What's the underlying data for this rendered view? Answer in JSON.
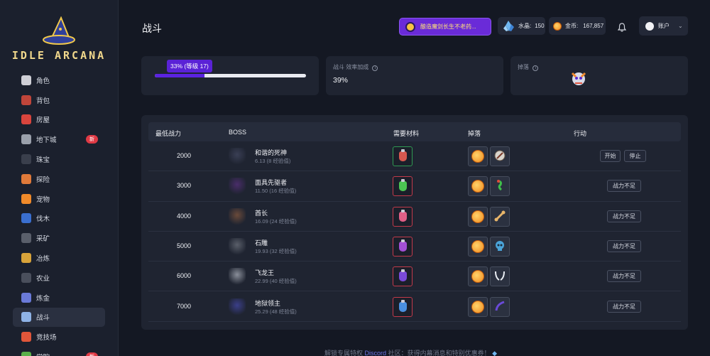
{
  "app": {
    "logo_text": "IDLE ARCANA"
  },
  "sidebar": {
    "items": [
      {
        "label": "角色",
        "icon": "skull-character-icon",
        "color": "#cfcfd6"
      },
      {
        "label": "背包",
        "icon": "backpack-icon",
        "color": "#c0453a"
      },
      {
        "label": "房屋",
        "icon": "house-icon",
        "color": "#d9453d"
      },
      {
        "label": "地下城",
        "icon": "dungeon-gate-icon",
        "color": "#9aa0ab",
        "badge": "新"
      },
      {
        "label": "珠宝",
        "icon": "gem-ring-icon",
        "color": "#3a3f4c"
      },
      {
        "label": "探险",
        "icon": "map-icon",
        "color": "#e07a3a"
      },
      {
        "label": "宠物",
        "icon": "pet-egg-icon",
        "color": "#f08a2a"
      },
      {
        "label": "伐木",
        "icon": "axe-icon",
        "color": "#3a6fd0"
      },
      {
        "label": "采矿",
        "icon": "pickaxe-icon",
        "color": "#5a5f6b"
      },
      {
        "label": "冶炼",
        "icon": "anvil-icon",
        "color": "#d8a33a"
      },
      {
        "label": "农业",
        "icon": "scythe-icon",
        "color": "#4a4f5c"
      },
      {
        "label": "炼金",
        "icon": "alchemy-icon",
        "color": "#6a7ad8"
      },
      {
        "label": "战斗",
        "icon": "sword-icon",
        "color": "#8fb3e6",
        "active": true
      },
      {
        "label": "竞技场",
        "icon": "arena-shield-icon",
        "color": "#e0563a"
      },
      {
        "label": "学院",
        "icon": "academy-icon",
        "color": "#5ab04a",
        "badge": "新"
      }
    ]
  },
  "header": {
    "title": "战斗",
    "promo_label": "酿造魔剑长生不老药...",
    "crystal_label": "水晶:",
    "crystal_value": "150",
    "gold_label": "金币:",
    "gold_value": "167,857",
    "account_label": "账户"
  },
  "stats": {
    "progress_label": "33% (等级 17)",
    "progress_fraction": 0.33,
    "efficiency_label": "战斗 效率加成",
    "efficiency_value": "39%",
    "drop_label": "掉落"
  },
  "table": {
    "headers": {
      "power": "最低战力",
      "boss": "BOSS",
      "materials": "需要材料",
      "drops": "掉落",
      "action": "行动"
    },
    "rows": [
      {
        "power": "2000",
        "boss": "和谐的死神",
        "sub": "6.13 (8 经验值)",
        "boss_color": "#3a3f55",
        "potion": "#d6584f",
        "mat_border": "#2f9a52",
        "drop2": "compass",
        "actions": [
          "开始",
          "停止"
        ]
      },
      {
        "power": "3000",
        "boss": "面具先驱者",
        "sub": "11.50 (16 经验值)",
        "boss_color": "#4a2d6a",
        "potion": "#4cc452",
        "mat_border": "#c23a4a",
        "drop2": "green-snake",
        "actions": [
          "战力不足"
        ]
      },
      {
        "power": "4000",
        "boss": "酋长",
        "sub": "16.09 (24 经验值)",
        "boss_color": "#6a4a3a",
        "potion": "#e05f86",
        "mat_border": "#c23a4a",
        "drop2": "bone",
        "actions": [
          "战力不足"
        ]
      },
      {
        "power": "5000",
        "boss": "石雕",
        "sub": "19.93 (32 经验值)",
        "boss_color": "#5a5f6a",
        "potion": "#a24fd4",
        "mat_border": "#c23a4a",
        "drop2": "blue-skull",
        "actions": [
          "战力不足"
        ]
      },
      {
        "power": "6000",
        "boss": "飞龙王",
        "sub": "22.99 (40 经验值)",
        "boss_color": "#8a8f9a",
        "potion": "#7a4ad8",
        "mat_border": "#c23a4a",
        "drop2": "horns",
        "actions": [
          "战力不足"
        ]
      },
      {
        "power": "7000",
        "boss": "地狱领主",
        "sub": "25.29 (48 经验值)",
        "boss_color": "#3b3f8a",
        "potion": "#4a8fe0",
        "mat_border": "#c23a4a",
        "drop2": "claw",
        "actions": [
          "战力不足"
        ]
      }
    ]
  },
  "footer": {
    "prefix": "解锁专属特权",
    "link": "Discord",
    "suffix": "社区：获得内幕消息和特别优惠券！"
  }
}
